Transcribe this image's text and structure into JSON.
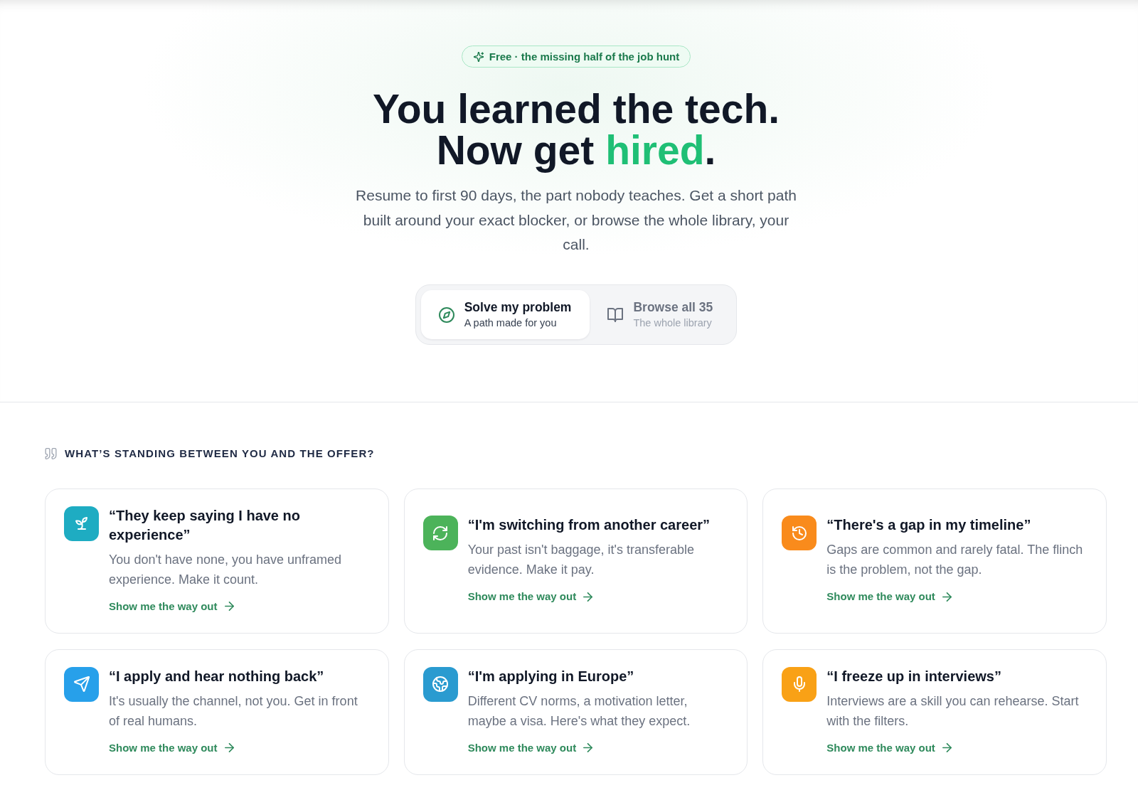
{
  "hero": {
    "badge": {
      "text": "Free · the missing half of the job hunt"
    },
    "headline": [
      [
        {
          "text": "You learned the tech.",
          "highlight": false
        }
      ],
      [
        {
          "text": "Now get ",
          "highlight": false
        },
        {
          "text": "hired",
          "highlight": true
        },
        {
          "text": ".",
          "highlight": false
        }
      ]
    ],
    "intro": "Resume to first 90 days, the part nobody teaches. Get a short path built around your exact blocker, or browse the whole library, your call.",
    "mode_switch": [
      {
        "kind": "compass",
        "title": "Solve my problem",
        "subtitle": "A path made for you",
        "selected": true
      },
      {
        "kind": "book",
        "title": "Browse all 35",
        "subtitle": "The whole library",
        "selected": false
      }
    ]
  },
  "problems": {
    "heading": "WHAT’S STANDING BETWEEN YOU AND THE OFFER?",
    "cards": [
      {
        "kind": "sprout",
        "color": "#1eacc2",
        "title": "“They keep saying I have no experience”",
        "description": "You don't have none, you have unframed experience. Make it count.",
        "link": "Show me the way out"
      },
      {
        "kind": "refresh",
        "color": "#4cb35a",
        "title": "“I'm switching from another career”",
        "description": "Your past isn't baggage, it's transferable evidence. Make it pay.",
        "link": "Show me the way out"
      },
      {
        "kind": "history",
        "color": "#f98b1c",
        "title": "“There's a gap in my timeline”",
        "description": "Gaps are common and rarely fatal. The flinch is the problem, not the gap.",
        "link": "Show me the way out"
      },
      {
        "kind": "send",
        "color": "#27a0ea",
        "title": "“I apply and hear nothing back”",
        "description": "It's usually the channel, not you. Get in front of real humans.",
        "link": "Show me the way out"
      },
      {
        "kind": "globe",
        "color": "#2a9bd0",
        "title": "“I'm applying in Europe”",
        "description": "Different CV norms, a motivation letter, maybe a visa. Here's what they expect.",
        "link": "Show me the way out"
      },
      {
        "kind": "mic",
        "color": "#f9a116",
        "title": "“I freeze up in interviews”",
        "description": "Interviews are a skill you can rehearse. Start with the filters.",
        "link": "Show me the way out"
      }
    ]
  }
}
